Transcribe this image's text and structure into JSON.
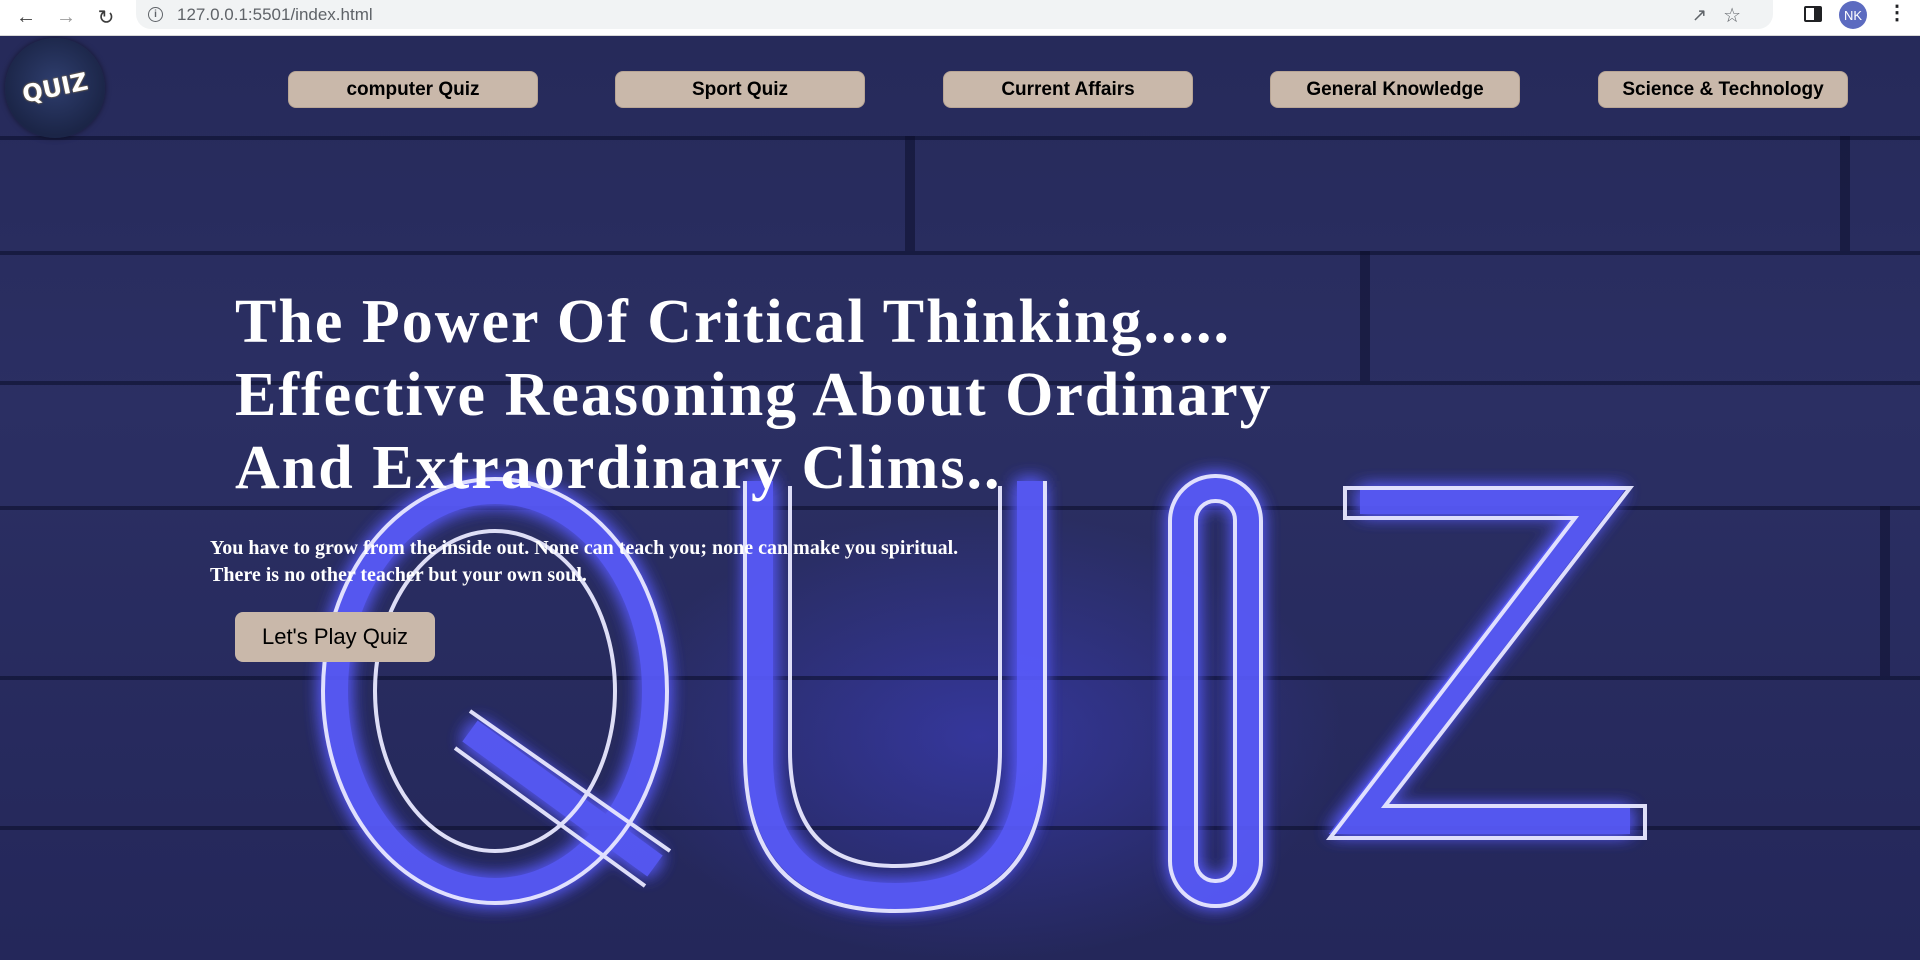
{
  "browser": {
    "url": "127.0.0.1:5501/index.html",
    "profile_initials": "NK",
    "icons": [
      "back-arrow-icon",
      "forward-arrow-icon",
      "reload-icon",
      "info-icon",
      "share-icon",
      "star-icon",
      "side-panel-icon",
      "kebab-menu-icon"
    ]
  },
  "logo": {
    "text": "QUIZ"
  },
  "nav": {
    "items": [
      {
        "label": "computer Quiz"
      },
      {
        "label": "Sport Quiz"
      },
      {
        "label": "Current Affairs"
      },
      {
        "label": "General Knowledge"
      },
      {
        "label": "Science & Technology"
      }
    ]
  },
  "hero": {
    "headline_lines": [
      "The Power Of Critical Thinking.....",
      "Effective Reasoning About Ordinary",
      "And Extraordinary Clims.."
    ],
    "quote_lines": [
      "You have to grow from the inside out. None can teach you; none can make you spiritual.",
      "There is no other teacher but your own soul."
    ],
    "cta_label": "Let's Play Quiz"
  },
  "colors": {
    "nav_button_bg": "#c9b8aa",
    "page_bg": "#262a5a",
    "neon": "#5a5cff"
  }
}
